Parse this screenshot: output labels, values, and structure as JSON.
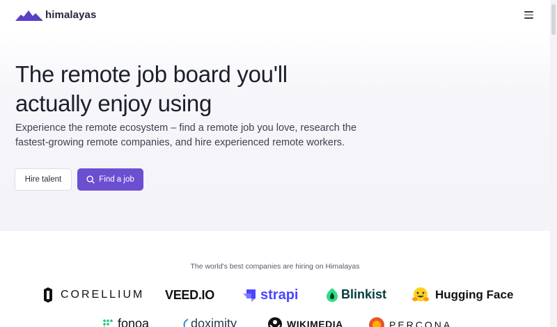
{
  "header": {
    "logo_text": "himalayas",
    "logo_icon": "mountain-icon",
    "menu_icon": "hamburger-menu-icon"
  },
  "hero": {
    "title_line1": "The remote job board you'll",
    "title_line2": "actually enjoy using",
    "subtitle_line1": "Experience the remote ecosystem – find a remote job you love, research the",
    "subtitle_line2": "fastest-growing remote companies, and hire experienced remote workers.",
    "hire_button": "Hire talent",
    "find_button": "Find a job",
    "find_button_icon": "search-icon"
  },
  "companies": {
    "caption": "The world's best companies are hiring on Himalayas",
    "logos": [
      {
        "name": "CORELLIUM",
        "icon": "corellium-icon"
      },
      {
        "name": "VEED.IO",
        "icon": ""
      },
      {
        "name": "strapi",
        "icon": "strapi-icon"
      },
      {
        "name": "Blinkist",
        "icon": "blinkist-icon"
      },
      {
        "name": "Hugging Face",
        "icon": "hugging-face-emoji-icon"
      },
      {
        "name": "fonoa",
        "icon": "fonoa-icon"
      },
      {
        "name": "doximity",
        "icon": "doximity-icon"
      },
      {
        "name": "WIKIMEDIA",
        "icon": "wikimedia-icon"
      },
      {
        "name": "PERCONA",
        "icon": "percona-icon"
      }
    ]
  },
  "colors": {
    "accent": "#6b4fd0",
    "logo_mountain": "#5b3fc4",
    "text_dark": "#1c1f2b",
    "hero_bg": "#f3f3f8"
  }
}
